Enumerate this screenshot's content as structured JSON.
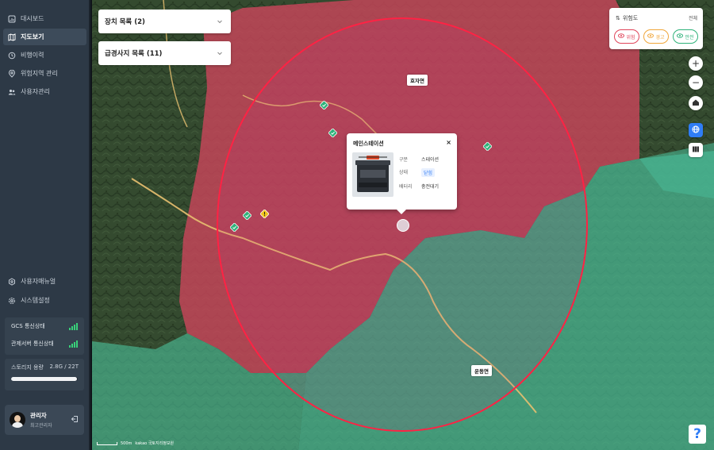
{
  "sidebar": {
    "items": [
      {
        "label": "대시보드",
        "icon": "dashboard-icon"
      },
      {
        "label": "지도보기",
        "icon": "map-icon",
        "active": true
      },
      {
        "label": "비행이력",
        "icon": "flight-history-icon"
      },
      {
        "label": "위험지역 관리",
        "icon": "danger-zone-icon"
      },
      {
        "label": "사용자관리",
        "icon": "users-icon"
      }
    ],
    "bottom_items": [
      {
        "label": "사용자매뉴얼",
        "icon": "manual-icon"
      },
      {
        "label": "시스템설정",
        "icon": "gear-icon"
      }
    ],
    "status": {
      "gcs_label": "GCS 통신상태",
      "control_server_label": "관제서버 통신상태"
    },
    "storage": {
      "label": "스토리지 용량",
      "value": "2.8G / 22T",
      "fill_fraction": 0.99
    },
    "user": {
      "name": "관리자",
      "role": "최고관리자"
    }
  },
  "panels": {
    "device_list": "장치 목록 (2)",
    "slope_list": "급경사지 목록 (11)"
  },
  "risk_filter": {
    "title": "위험도",
    "all_label": "전체",
    "options": [
      {
        "label": "위험",
        "color": "#e0455a"
      },
      {
        "label": "경고",
        "color": "#f0a63a"
      },
      {
        "label": "안전",
        "color": "#2fb27a"
      }
    ]
  },
  "map": {
    "place_labels": [
      "호자면",
      "운동면"
    ],
    "attribution": "kakao 국토지리정보원",
    "scale_label": "500m",
    "colors": {
      "danger": "#c8455a",
      "safe": "#4ab894",
      "circle": "#ff2244"
    }
  },
  "popup": {
    "title": "메인스테이션",
    "close": "×",
    "rows": [
      {
        "key": "구분",
        "value": "스테이션"
      },
      {
        "key": "상태",
        "value": "닫힘"
      },
      {
        "key": "배터리",
        "value": "충전대기"
      }
    ]
  },
  "help": {
    "label": "?"
  }
}
